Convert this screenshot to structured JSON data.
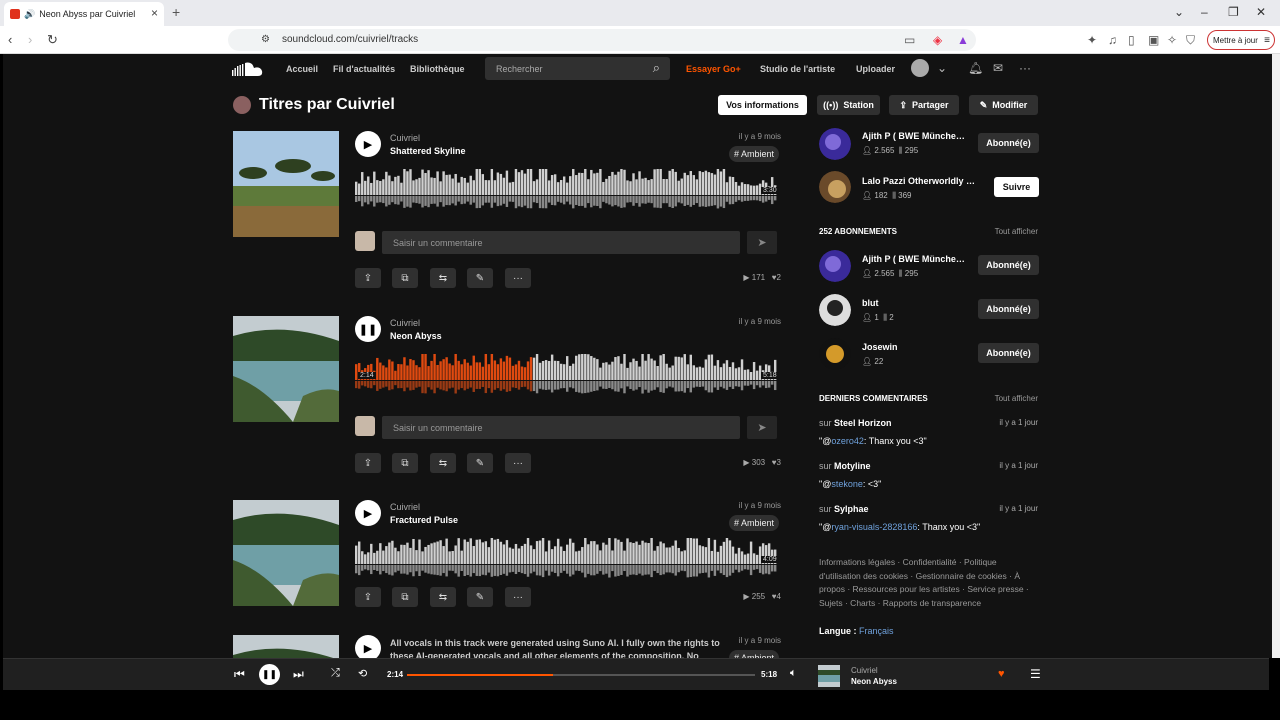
{
  "browser": {
    "tab_title": "Neon Abyss par Cuivriel",
    "url": "soundcloud.com/cuivriel/tracks",
    "update_label": "Mettre à jour"
  },
  "nav": {
    "items": [
      "Accueil",
      "Fil d'actualités",
      "Bibliothèque"
    ],
    "search_placeholder": "Rechercher",
    "go_label": "Essayer Go+",
    "studio": "Studio de l'artiste",
    "upload": "Uploader"
  },
  "header": {
    "title": "Titres par Cuivriel",
    "buttons": {
      "info": "Vos informations",
      "station": "Station",
      "share": "Partager",
      "edit": "Modifier"
    }
  },
  "comment_placeholder": "Saisir un commentaire",
  "tracks": [
    {
      "artist": "Cuivriel",
      "title": "Shattered Skyline",
      "ago": "il y a 9 mois",
      "tag": "# Ambient",
      "duration": "3:30",
      "plays": "171",
      "likes": "2"
    },
    {
      "artist": "Cuivriel",
      "title": "Neon Abyss",
      "ago": "il y a 9 mois",
      "position": "2:14",
      "duration": "5:18",
      "plays": "303",
      "likes": "3",
      "progress": 0.42
    },
    {
      "artist": "Cuivriel",
      "title": "Fractured Pulse",
      "ago": "il y a 9 mois",
      "tag": "# Ambient",
      "duration": "4:09",
      "plays": "255",
      "likes": "4"
    },
    {
      "description": "All vocals in this track were generated using Suno AI. I fully own the rights to these AI-generated vocals and all other elements of the composition. No",
      "ago": "il y a 9 mois",
      "tag": "# Ambient"
    }
  ],
  "sidebar": {
    "top_users": [
      {
        "name": "Ajith P ( BWE Münche…",
        "followers": "2.565",
        "tracks": "295",
        "button": "Abonné(e)"
      },
      {
        "name": "Lalo Pazzi Otherworldly …",
        "followers": "182",
        "tracks": "369",
        "button": "Suivre"
      }
    ],
    "following_header": "252 ABONNEMENTS",
    "see_all": "Tout afficher",
    "following": [
      {
        "name": "Ajith P ( BWE Münche…",
        "followers": "2.565",
        "tracks": "295",
        "button": "Abonné(e)"
      },
      {
        "name": "blut",
        "followers": "1",
        "tracks": "2",
        "button": "Abonné(e)"
      },
      {
        "name": "Josewin",
        "followers": "22",
        "button": "Abonné(e)"
      }
    ],
    "comments_header": "DERNIERS COMMENTAIRES",
    "comments": [
      {
        "prefix": "sur",
        "track": "Steel Horizon",
        "ago": "il y a 1 jour",
        "mention": "ozero42",
        "text": ": Thanx you <3\""
      },
      {
        "prefix": "sur",
        "track": "Motyline",
        "ago": "il y a 1 jour",
        "mention": "stekone",
        "text": ": <3\""
      },
      {
        "prefix": "sur",
        "track": "Sylphae",
        "ago": "il y a 1 jour",
        "mention": "ryan-visuals-2828166",
        "text": ": Thanx you <3\""
      }
    ],
    "footer": "Informations légales · Confidentialité · Politique d'utilisation des cookies · Gestionnaire de cookies · À propos · Ressources pour les artistes · Service presse · Sujets · Charts · Rapports de transparence",
    "lang_label": "Langue :",
    "lang_value": "Français"
  },
  "player": {
    "elapsed": "2:14",
    "total": "5:18",
    "progress": 0.42,
    "artist": "Cuivriel",
    "track": "Neon Abyss"
  }
}
